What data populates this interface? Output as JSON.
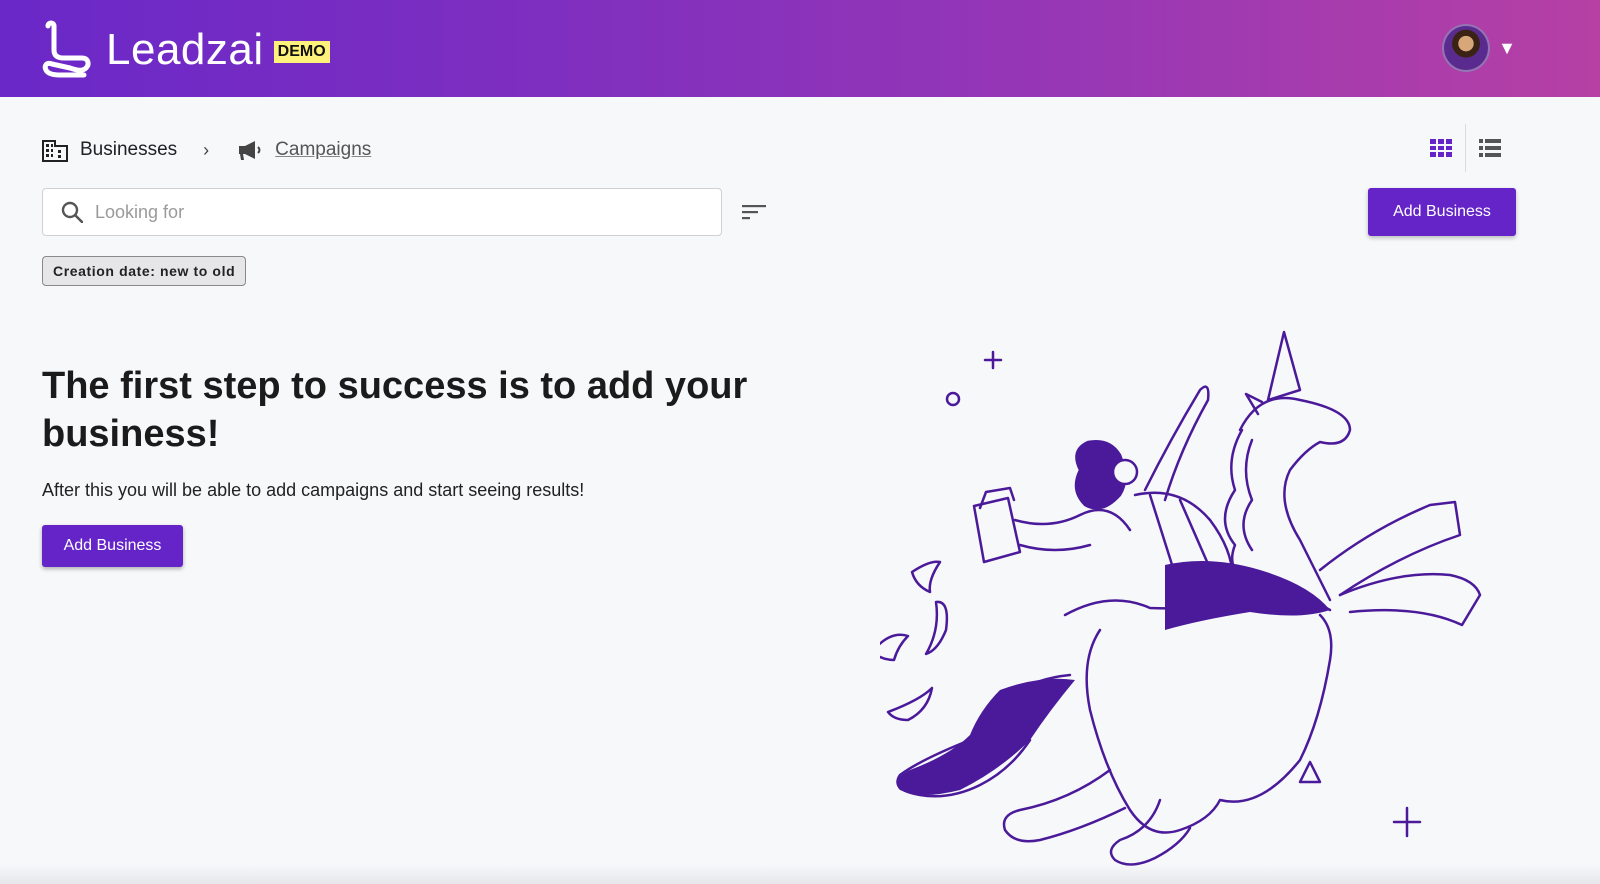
{
  "header": {
    "brand_name": "Leadzai",
    "env_badge": "DEMO",
    "user_menu_caret": "▼",
    "gradient_colors": [
      "#6a28c8",
      "#b640a4"
    ]
  },
  "breadcrumb": {
    "items": [
      {
        "label": "Businesses",
        "icon": "building-icon"
      },
      {
        "label": "Campaigns",
        "icon": "megaphone-icon"
      }
    ],
    "separator": "›"
  },
  "view_toggles": {
    "grid": "grid-view-icon",
    "list": "list-view-icon",
    "active": "grid"
  },
  "search": {
    "placeholder": "Looking for",
    "value": ""
  },
  "toolbar": {
    "add_business_label": "Add Business"
  },
  "filters": {
    "sort_chip": "Creation date: new to old"
  },
  "empty_state": {
    "title": "The first step to success is to add your business!",
    "subtitle": "After this you will be able to add campaigns and start seeing results!",
    "cta_label": "Add Business",
    "illustration": "person-riding-unicorn-illustration"
  },
  "colors": {
    "accent": "#6424c8",
    "illustration": "#4a1a9a",
    "background": "#f7f8fa"
  }
}
